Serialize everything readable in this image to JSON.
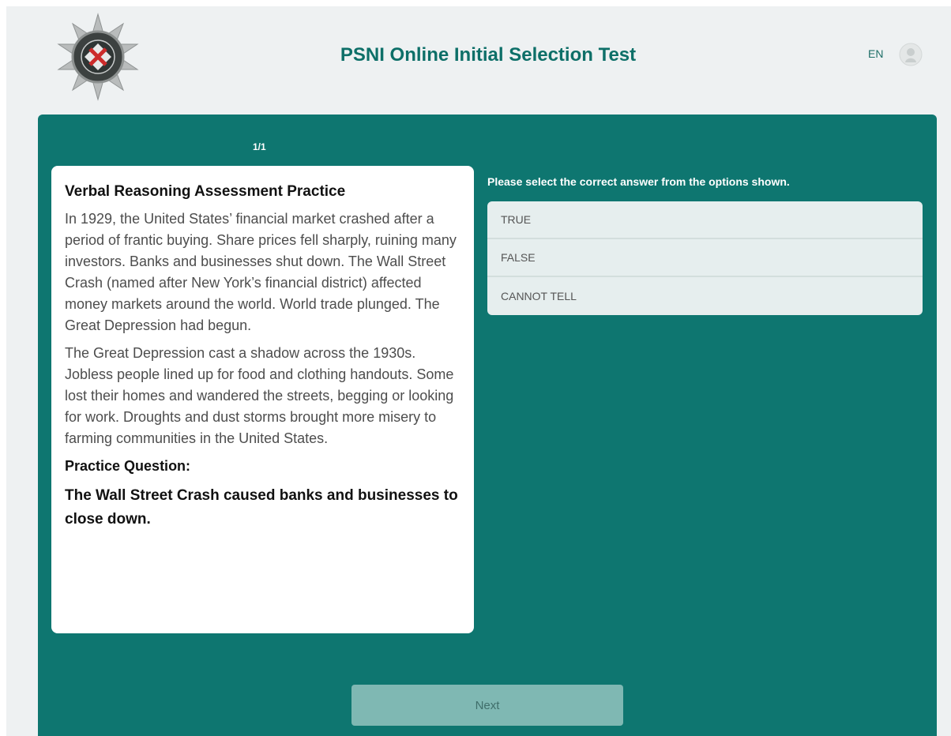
{
  "header": {
    "title": "PSNI Online Initial Selection Test",
    "language": "EN"
  },
  "progress": "1/1",
  "passage": {
    "title": "Verbal Reasoning Assessment Practice",
    "paragraphs": [
      "In 1929, the United States’ financial market crashed after a period of frantic buying. Share prices fell sharply, ruining many investors. Banks and businesses shut down. The Wall Street Crash (named after New York’s financial district) affected money markets around the world. World trade plunged. The Great Depression had begun.",
      "The Great Depression cast a shadow across the 1930s.  Jobless people lined up for food and clothing handouts.  Some lost their homes and wandered the streets, begging or looking for work.  Droughts and dust storms brought more misery to farming communities in the United States."
    ],
    "question_label": "Practice Question:",
    "question": "The Wall Street Crash caused banks and businesses to close down."
  },
  "instruction": "Please select the correct answer from the options shown.",
  "options": [
    "TRUE",
    "FALSE",
    "CANNOT TELL"
  ],
  "next_label": "Next",
  "colors": {
    "brand_teal": "#0e7670",
    "title_teal": "#0d6f68",
    "page_background": "#eef1f2",
    "option_background": "#e6eeee",
    "next_button": "#7fb8b3"
  },
  "icons": {
    "logo": "psni-crest-icon",
    "user": "user-avatar-icon"
  }
}
